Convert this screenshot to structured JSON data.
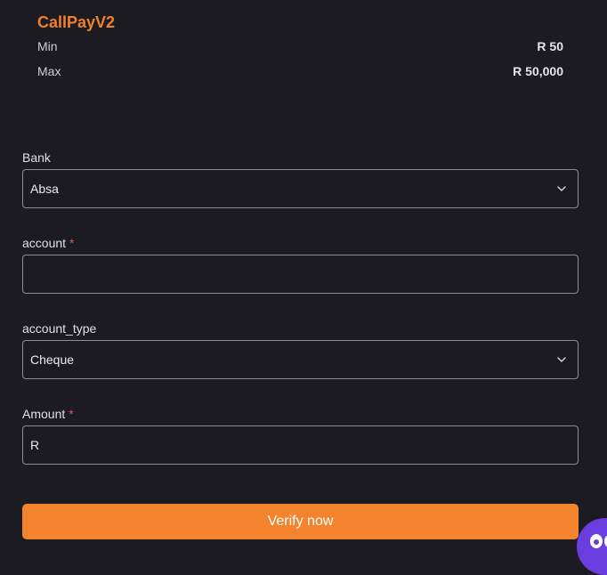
{
  "summary": {
    "provider_name": "CallPayV2",
    "min_label": "Min",
    "min_value": "R 50",
    "max_label": "Max",
    "max_value": "R 50,000"
  },
  "form": {
    "bank": {
      "label": "Bank",
      "value": "Absa"
    },
    "account": {
      "label": "account",
      "required_mark": "*",
      "value": ""
    },
    "account_type": {
      "label": "account_type",
      "value": "Cheque"
    },
    "amount": {
      "label": "Amount",
      "required_mark": "*",
      "value": "R"
    }
  },
  "actions": {
    "verify_label": "Verify now"
  },
  "colors": {
    "background": "#1c1b21",
    "accent": "#f3832c",
    "brand_text": "#f0812a",
    "required": "#e5534b",
    "chat_bubble": "#6a3de0"
  },
  "icons": [
    "chevron-down-icon",
    "chat-bot-icon"
  ]
}
